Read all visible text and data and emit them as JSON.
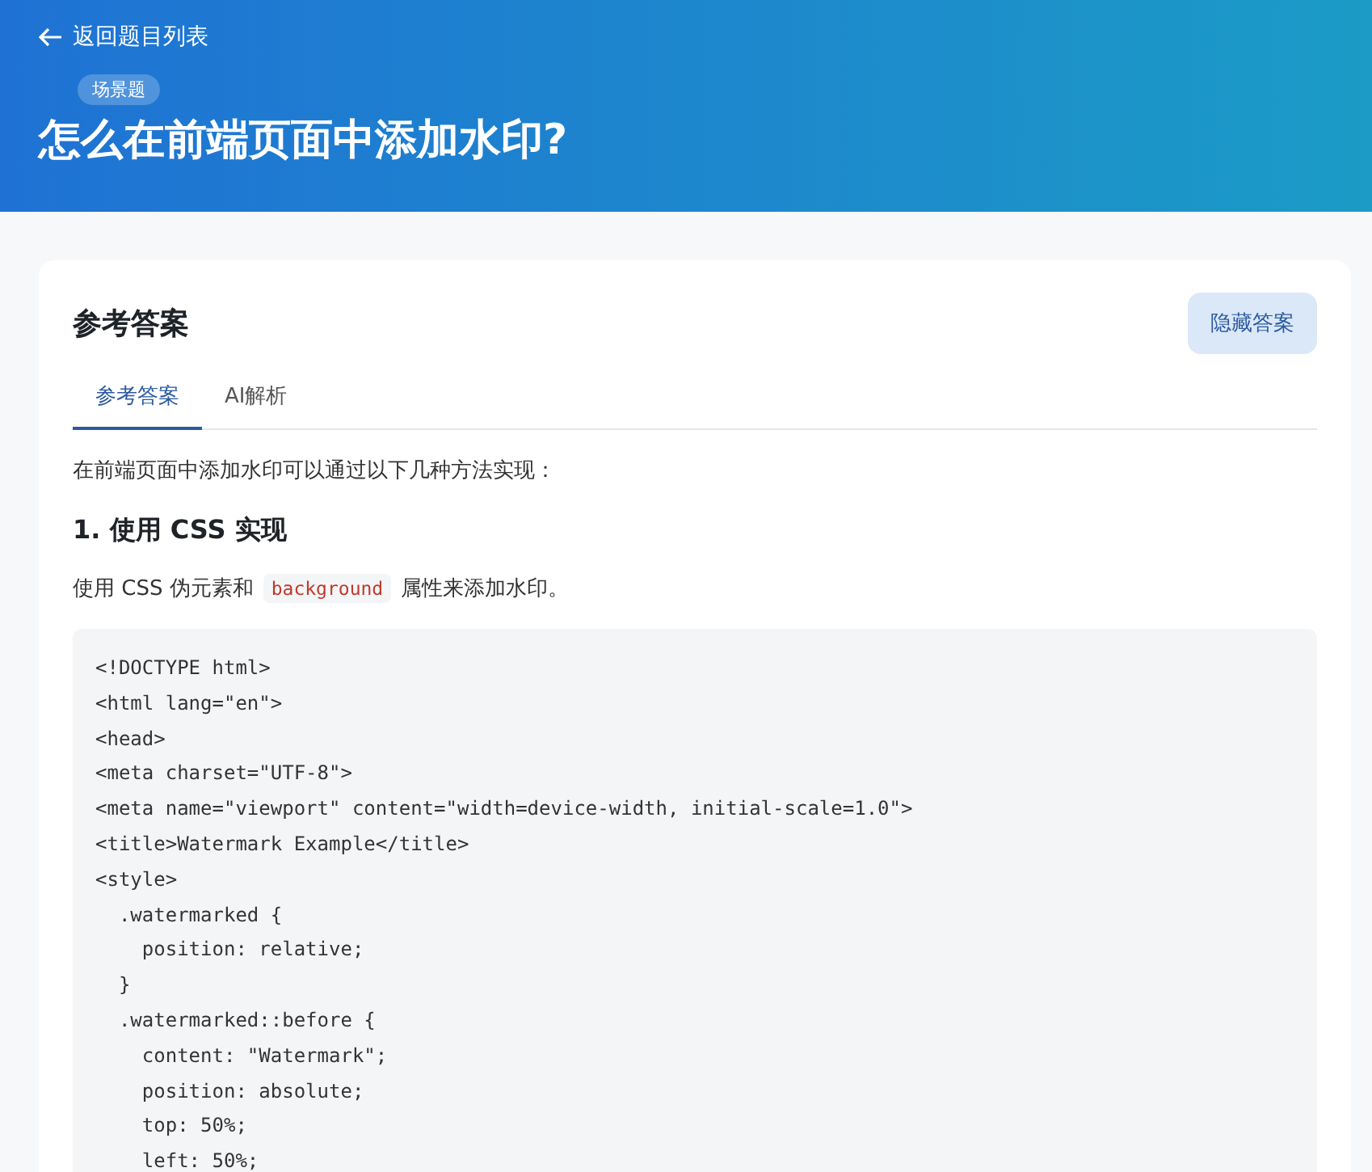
{
  "header": {
    "back_link": "返回题目列表",
    "tag": "场景题",
    "title": "怎么在前端页面中添加水印?"
  },
  "answer_card": {
    "heading": "参考答案",
    "toggle_button": "隐藏答案",
    "tabs": [
      {
        "label": "参考答案",
        "selected": true
      },
      {
        "label": "AI解析",
        "selected": false
      }
    ],
    "intro": "在前端页面中添加水印可以通过以下几种方法实现：",
    "section_heading": "1. 使用 CSS 实现",
    "section_text": {
      "before": "使用 CSS 伪元素和",
      "code": "background",
      "after": "属性来添加水印。"
    },
    "code_lines": [
      "<!DOCTYPE html>",
      "<html lang=\"en\">",
      "<head>",
      "<meta charset=\"UTF-8\">",
      "<meta name=\"viewport\" content=\"width=device-width, initial-scale=1.0\">",
      "<title>Watermark Example</title>",
      "<style>",
      "  .watermarked {",
      "    position: relative;",
      "  }",
      "  .watermarked::before {",
      "    content: \"Watermark\";",
      "    position: absolute;",
      "    top: 50%;",
      "    left: 50%;"
    ]
  }
}
